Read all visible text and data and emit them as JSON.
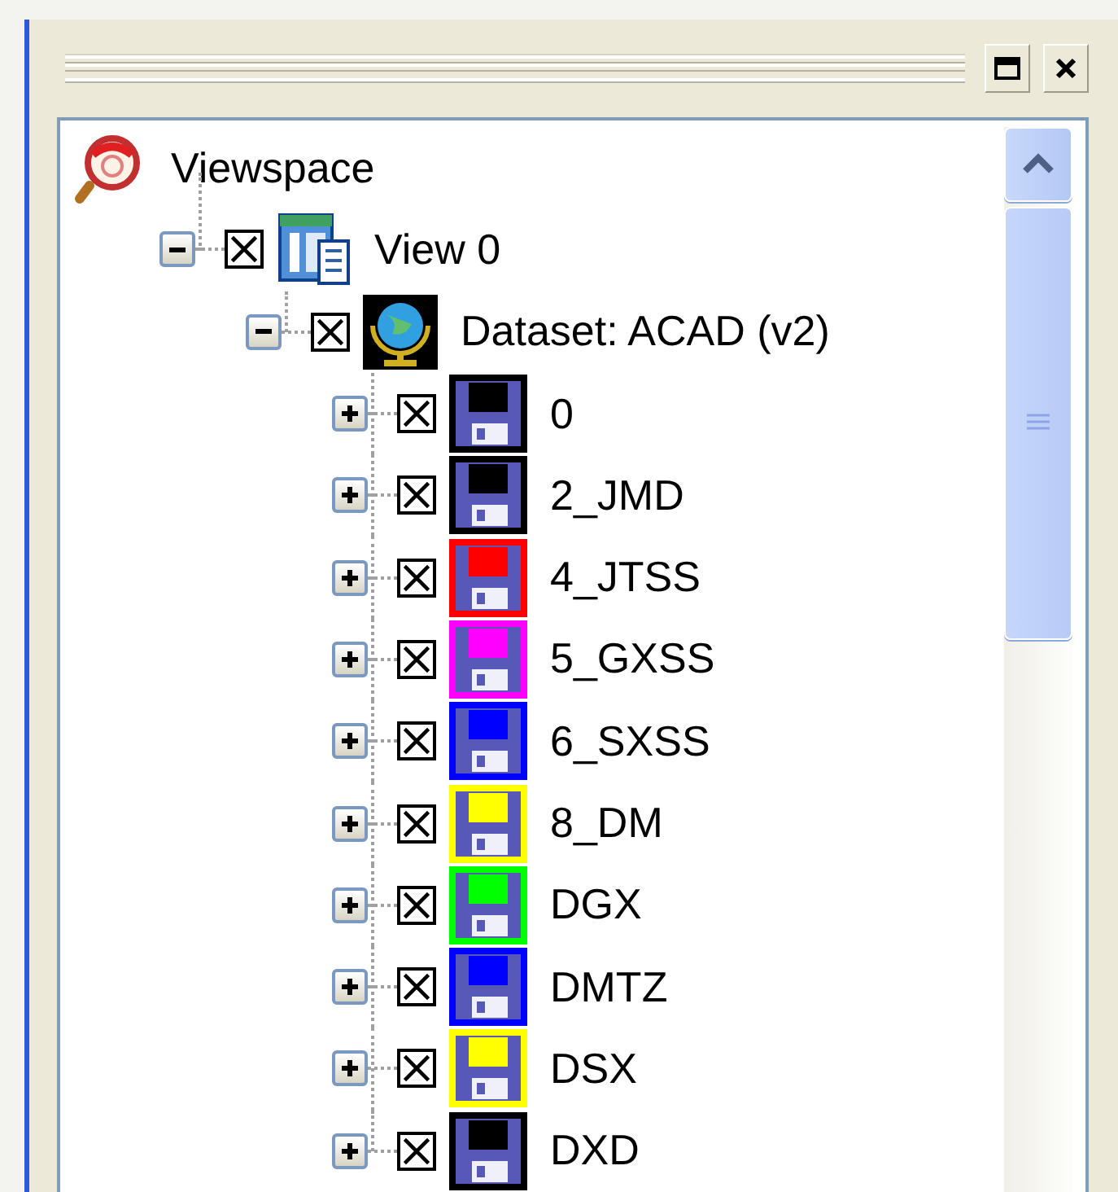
{
  "panel": {
    "tree": [
      {
        "label": "Viewspace",
        "kind": "viewspace",
        "children": [
          {
            "label": "View 0",
            "kind": "view",
            "expanded": true,
            "checked": true,
            "children": [
              {
                "label": "Dataset: ACAD (v2)",
                "kind": "dataset",
                "expanded": true,
                "checked": true,
                "children": [
                  {
                    "label": "0",
                    "kind": "layer",
                    "expanded": false,
                    "checked": true,
                    "color": "#000000"
                  },
                  {
                    "label": "2_JMD",
                    "kind": "layer",
                    "expanded": false,
                    "checked": true,
                    "color": "#000000"
                  },
                  {
                    "label": "4_JTSS",
                    "kind": "layer",
                    "expanded": false,
                    "checked": true,
                    "color": "#ff0000"
                  },
                  {
                    "label": "5_GXSS",
                    "kind": "layer",
                    "expanded": false,
                    "checked": true,
                    "color": "#ff00ff"
                  },
                  {
                    "label": "6_SXSS",
                    "kind": "layer",
                    "expanded": false,
                    "checked": true,
                    "color": "#0000ff"
                  },
                  {
                    "label": "8_DM",
                    "kind": "layer",
                    "expanded": false,
                    "checked": true,
                    "color": "#ffff00"
                  },
                  {
                    "label": "DGX",
                    "kind": "layer",
                    "expanded": false,
                    "checked": true,
                    "color": "#00ff00"
                  },
                  {
                    "label": "DMTZ",
                    "kind": "layer",
                    "expanded": false,
                    "checked": true,
                    "color": "#0000ff"
                  },
                  {
                    "label": "DSX",
                    "kind": "layer",
                    "expanded": false,
                    "checked": true,
                    "color": "#ffff00"
                  },
                  {
                    "label": "DXD",
                    "kind": "layer",
                    "expanded": false,
                    "checked": true,
                    "color": "#000000"
                  }
                ]
              }
            ]
          }
        ]
      }
    ]
  }
}
